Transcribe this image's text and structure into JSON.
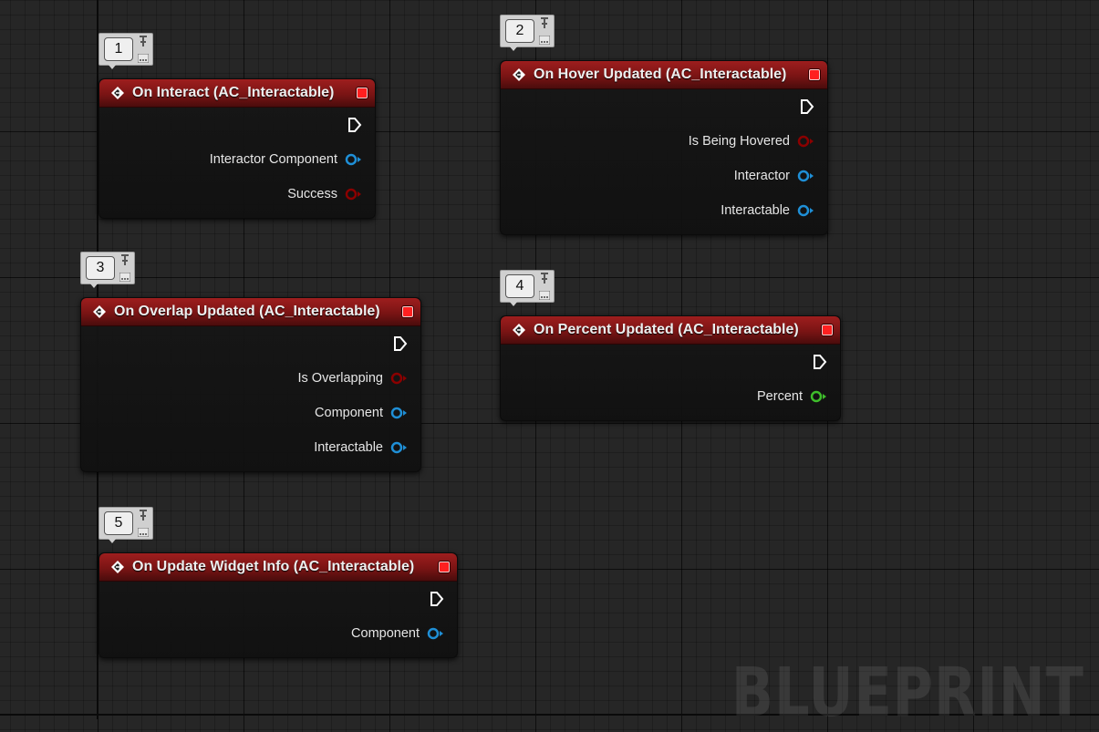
{
  "app": {
    "watermark": "BLUEPRINT"
  },
  "colors": {
    "header": "#7a1414",
    "bool_pin": "#8b0000",
    "object_pin": "#1f8fd6",
    "float_pin": "#3ebd2b",
    "exec_pin": "#ffffff",
    "delegate": "#ff2020"
  },
  "comments": [
    {
      "number": "1"
    },
    {
      "number": "2"
    },
    {
      "number": "3"
    },
    {
      "number": "4"
    },
    {
      "number": "5"
    }
  ],
  "nodes": [
    {
      "title": "On Interact (AC_Interactable)",
      "icon": "event-icon",
      "pins": [
        {
          "label": "Interactor Component",
          "type": "object"
        },
        {
          "label": "Success",
          "type": "bool"
        }
      ]
    },
    {
      "title": "On Hover Updated (AC_Interactable)",
      "icon": "event-icon",
      "pins": [
        {
          "label": "Is Being Hovered",
          "type": "bool"
        },
        {
          "label": "Interactor",
          "type": "object"
        },
        {
          "label": "Interactable",
          "type": "object"
        }
      ]
    },
    {
      "title": "On Overlap Updated (AC_Interactable)",
      "icon": "event-icon",
      "pins": [
        {
          "label": "Is Overlapping",
          "type": "bool"
        },
        {
          "label": "Component",
          "type": "object"
        },
        {
          "label": "Interactable",
          "type": "object"
        }
      ]
    },
    {
      "title": "On Percent Updated (AC_Interactable)",
      "icon": "event-icon",
      "pins": [
        {
          "label": "Percent",
          "type": "float"
        }
      ]
    },
    {
      "title": "On Update Widget Info (AC_Interactable)",
      "icon": "event-icon",
      "pins": [
        {
          "label": "Component",
          "type": "object"
        }
      ]
    }
  ]
}
